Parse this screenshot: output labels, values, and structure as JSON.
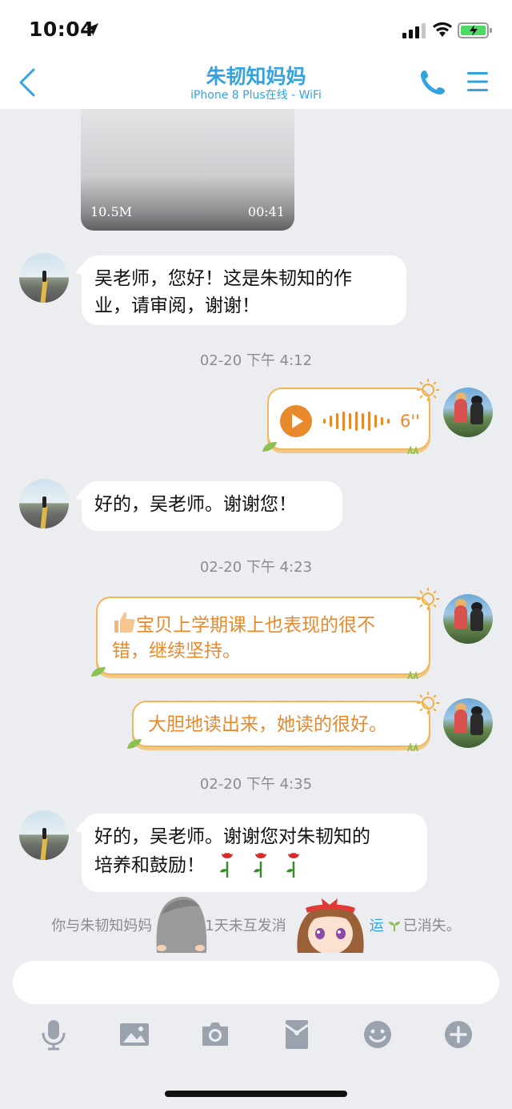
{
  "status_bar": {
    "time": "10:04"
  },
  "header": {
    "title": "朱韧知妈妈",
    "subtitle": "iPhone 8 Plus在线 - WiFi"
  },
  "messages": {
    "video": {
      "size": "10.5M",
      "duration": "00:41"
    },
    "in_1": {
      "text_line1": "吴老师，您好！这是朱韧知的作",
      "text_line2": "业，请审阅，谢谢！"
    },
    "ts_1": "02-20 下午 4:12",
    "voice": {
      "length": "6''"
    },
    "in_2": {
      "text": "好的，吴老师。谢谢您！"
    },
    "ts_2": "02-20 下午 4:23",
    "out_1": {
      "text_line1": "宝贝上学期课上也表现的很不",
      "text_line2": "错，继续坚持。"
    },
    "out_2": {
      "text": "大胆地读出来，她读的很好。"
    },
    "ts_3": "02-20 下午 4:35",
    "in_3": {
      "text_line1": "好的，吴老师。谢谢您对朱韧知的",
      "text_line2": "培养和鼓励！"
    }
  },
  "system_notice": {
    "left": "你与朱韧知妈妈",
    "middle": "1天未互发消",
    "highlight": "运",
    "right": "已消失。"
  },
  "input": {
    "value": ""
  },
  "toolbar": {
    "icons": [
      "microphone-icon",
      "image-icon",
      "camera-icon",
      "red-packet-icon",
      "emoji-icon",
      "plus-icon"
    ]
  },
  "colors": {
    "accent_blue": "#33a3e0",
    "bubble_orange": "#e8892c",
    "bubble_border": "#f2b557",
    "background": "#ebedf1"
  }
}
